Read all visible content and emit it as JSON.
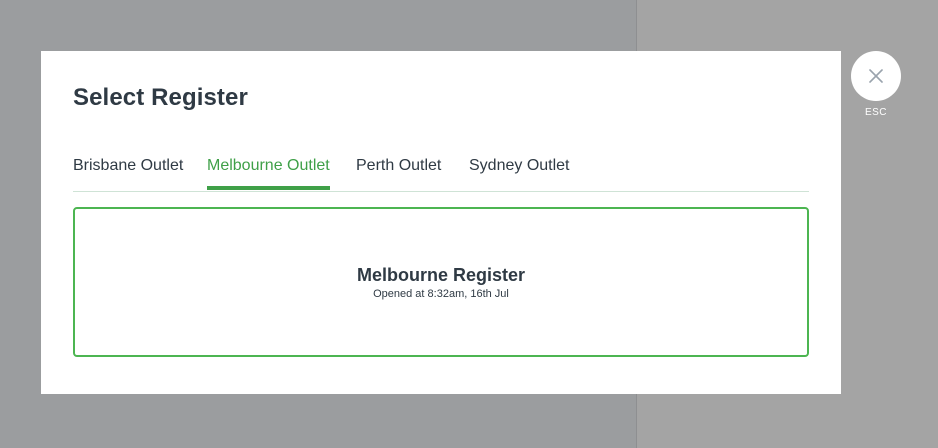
{
  "modal": {
    "title": "Select Register"
  },
  "tabs": [
    {
      "label": "Brisbane Outlet",
      "active": false
    },
    {
      "label": "Melbourne Outlet",
      "active": true
    },
    {
      "label": "Perth Outlet",
      "active": false
    },
    {
      "label": "Sydney Outlet",
      "active": false
    }
  ],
  "register": {
    "name": "Melbourne Register",
    "opened": "Opened at 8:32am, 16th Jul"
  },
  "close": {
    "icon": "close-icon",
    "label": "ESC"
  },
  "colors": {
    "accent": "#3fa048",
    "text": "#2f3a44",
    "overlay": "#9b9d9f"
  }
}
